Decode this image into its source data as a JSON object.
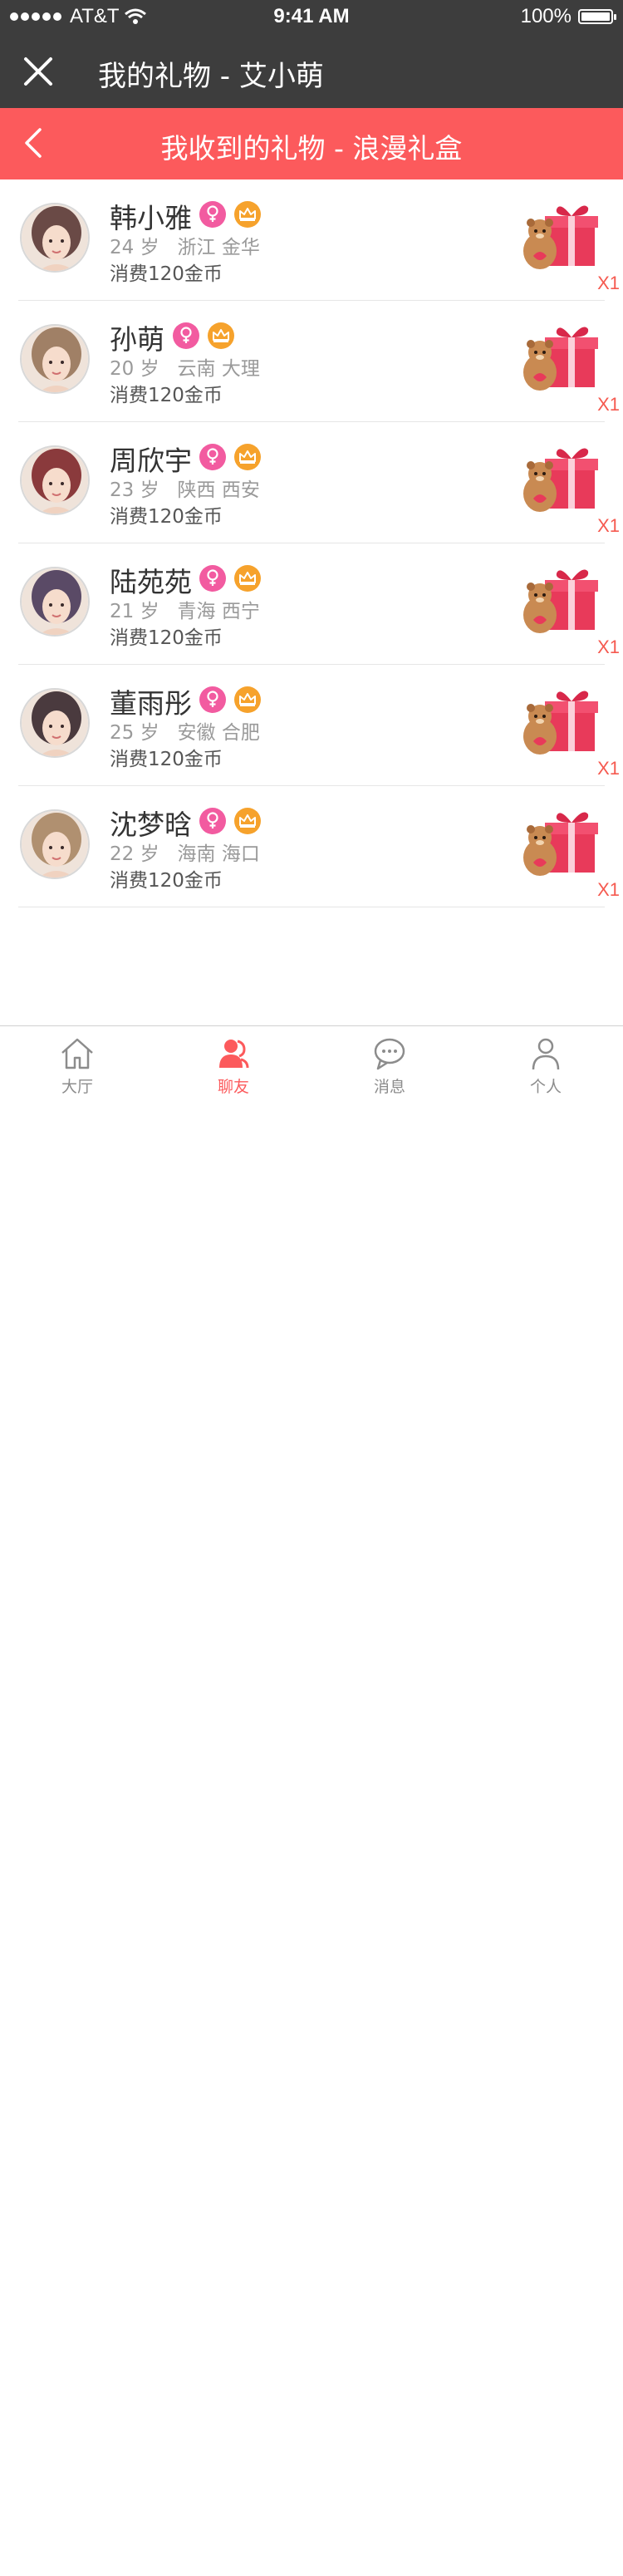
{
  "status_bar": {
    "carrier": "AT&T",
    "time": "9:41 AM",
    "battery": "100%"
  },
  "header": {
    "title": "我的礼物 - 艾小萌"
  },
  "subheader": {
    "title": "我收到的礼物 - 浪漫礼盒"
  },
  "gifts": [
    {
      "name": "韩小雅",
      "age": "24 岁",
      "location": "浙江 金华",
      "spent": "消费120金币",
      "qty": "X1",
      "avatar_color": "#6a4a46"
    },
    {
      "name": "孙萌",
      "age": "20 岁",
      "location": "云南 大理",
      "spent": "消费120金币",
      "qty": "X1",
      "avatar_color": "#a08066"
    },
    {
      "name": "周欣宇",
      "age": "23 岁",
      "location": "陕西 西安",
      "spent": "消费120金币",
      "qty": "X1",
      "avatar_color": "#8a3a3c"
    },
    {
      "name": "陆苑苑",
      "age": "21 岁",
      "location": "青海 西宁",
      "spent": "消费120金币",
      "qty": "X1",
      "avatar_color": "#5a4a66"
    },
    {
      "name": "董雨彤",
      "age": "25 岁",
      "location": "安徽 合肥",
      "spent": "消费120金币",
      "qty": "X1",
      "avatar_color": "#4a3a3e"
    },
    {
      "name": "沈梦晗",
      "age": "22 岁",
      "location": "海南 海口",
      "spent": "消费120金币",
      "qty": "X1",
      "avatar_color": "#b09070"
    }
  ],
  "tabs": [
    {
      "label": "大厅",
      "icon": "home-icon"
    },
    {
      "label": "聊友",
      "icon": "friends-icon",
      "active": true
    },
    {
      "label": "消息",
      "icon": "message-icon"
    },
    {
      "label": "个人",
      "icon": "person-icon"
    }
  ],
  "colors": {
    "accent": "#fc5a5c",
    "header_bg": "#3d3d3d",
    "female_badge": "#f25ba0",
    "crown_badge": "#f6a22c"
  }
}
